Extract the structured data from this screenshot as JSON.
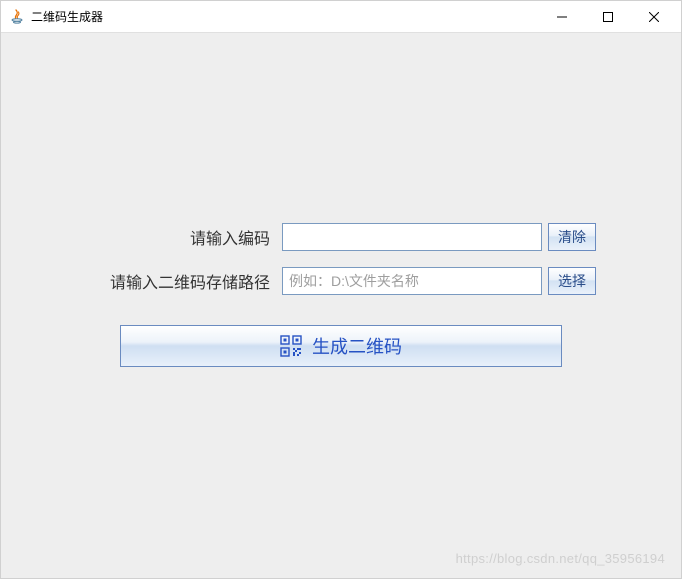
{
  "window": {
    "title": "二维码生成器"
  },
  "form": {
    "input_code": {
      "label": "请输入编码",
      "value": "",
      "clear_button": "清除"
    },
    "input_path": {
      "label": "请输入二维码存储路径",
      "placeholder": "例如：D:\\文件夹名称",
      "value": "",
      "browse_button": "选择"
    },
    "generate_button": "生成二维码"
  },
  "watermark": "https://blog.csdn.net/qq_35956194"
}
